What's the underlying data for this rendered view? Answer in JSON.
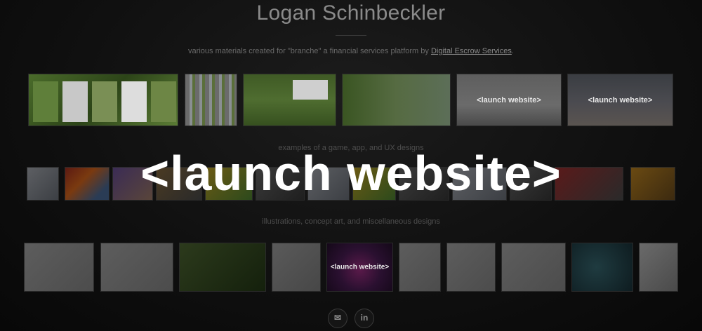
{
  "header": {
    "title": "Logan Schinbeckler",
    "subtitle_prefix": "various materials created for \"branche\" a financial services platform by ",
    "subtitle_link": "Digital Escrow Services",
    "subtitle_suffix": "."
  },
  "sections": {
    "games_label": "examples of a game, app, and UX designs",
    "illustrations_label": "illustrations, concept art, and miscellaneous designs"
  },
  "thumb_overlays": {
    "launch": "<launch website>"
  },
  "hero_overlay": "<launch website>",
  "social": {
    "email_icon": "envelope-icon",
    "linkedin_label": "in"
  }
}
